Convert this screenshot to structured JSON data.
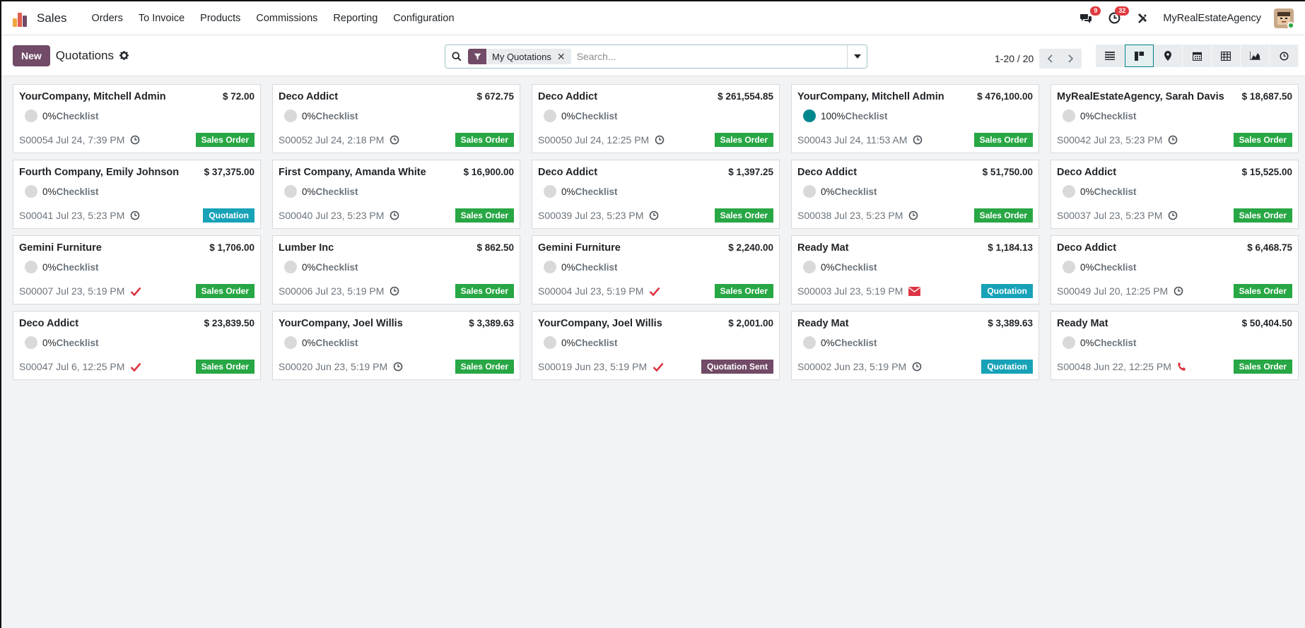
{
  "navbar": {
    "app_name": "Sales",
    "menu": [
      "Orders",
      "To Invoice",
      "Products",
      "Commissions",
      "Reporting",
      "Configuration"
    ],
    "messages_count": "9",
    "activities_count": "32",
    "company": "MyRealEstateAgency"
  },
  "control": {
    "new_label": "New",
    "title": "Quotations",
    "facet_label": "My Quotations",
    "search_placeholder": "Search...",
    "pager": "1-20 / 20"
  },
  "colors": {
    "brand": "#714b67",
    "sales_order": "#28a745",
    "quotation": "#17a2b8",
    "quotation_sent": "#714b67",
    "progress_full": "#00878d"
  },
  "cards": [
    {
      "customer": "YourCompany, Mitchell Admin",
      "amount": "$ 72.00",
      "progress": "0%",
      "checklist": "Checklist",
      "ref": "S00054 Jul 24, 7:39 PM",
      "activity": "clock-icon",
      "status": "Sales Order",
      "status_type": "sales_order"
    },
    {
      "customer": "Deco Addict",
      "amount": "$ 672.75",
      "progress": "0%",
      "checklist": "Checklist",
      "ref": "S00052 Jul 24, 2:18 PM",
      "activity": "clock-icon",
      "status": "Sales Order",
      "status_type": "sales_order"
    },
    {
      "customer": "Deco Addict",
      "amount": "$ 261,554.85",
      "progress": "0%",
      "checklist": "Checklist",
      "ref": "S00050 Jul 24, 12:25 PM",
      "activity": "clock-icon",
      "status": "Sales Order",
      "status_type": "sales_order"
    },
    {
      "customer": "YourCompany, Mitchell Admin",
      "amount": "$ 476,100.00",
      "progress": "100%",
      "checklist": "Checklist",
      "ref": "S00043 Jul 24, 11:53 AM",
      "activity": "clock-icon",
      "status": "Sales Order",
      "status_type": "sales_order"
    },
    {
      "customer": "MyRealEstateAgency, Sarah Davis",
      "amount": "$ 18,687.50",
      "progress": "0%",
      "checklist": "Checklist",
      "ref": "S00042 Jul 23, 5:23 PM",
      "activity": "clock-icon",
      "status": "Sales Order",
      "status_type": "sales_order"
    },
    {
      "customer": "Fourth Company, Emily Johnson",
      "amount": "$ 37,375.00",
      "progress": "0%",
      "checklist": "Checklist",
      "ref": "S00041 Jul 23, 5:23 PM",
      "activity": "clock-icon",
      "status": "Quotation",
      "status_type": "quotation"
    },
    {
      "customer": "First Company, Amanda White",
      "amount": "$ 16,900.00",
      "progress": "0%",
      "checklist": "Checklist",
      "ref": "S00040 Jul 23, 5:23 PM",
      "activity": "clock-icon",
      "status": "Sales Order",
      "status_type": "sales_order"
    },
    {
      "customer": "Deco Addict",
      "amount": "$ 1,397.25",
      "progress": "0%",
      "checklist": "Checklist",
      "ref": "S00039 Jul 23, 5:23 PM",
      "activity": "clock-icon",
      "status": "Sales Order",
      "status_type": "sales_order"
    },
    {
      "customer": "Deco Addict",
      "amount": "$ 51,750.00",
      "progress": "0%",
      "checklist": "Checklist",
      "ref": "S00038 Jul 23, 5:23 PM",
      "activity": "clock-icon",
      "status": "Sales Order",
      "status_type": "sales_order"
    },
    {
      "customer": "Deco Addict",
      "amount": "$ 15,525.00",
      "progress": "0%",
      "checklist": "Checklist",
      "ref": "S00037 Jul 23, 5:23 PM",
      "activity": "clock-icon",
      "status": "Sales Order",
      "status_type": "sales_order"
    },
    {
      "customer": "Gemini Furniture",
      "amount": "$ 1,706.00",
      "progress": "0%",
      "checklist": "Checklist",
      "ref": "S00007 Jul 23, 5:19 PM",
      "activity": "check-icon",
      "status": "Sales Order",
      "status_type": "sales_order"
    },
    {
      "customer": "Lumber Inc",
      "amount": "$ 862.50",
      "progress": "0%",
      "checklist": "Checklist",
      "ref": "S00006 Jul 23, 5:19 PM",
      "activity": "clock-icon",
      "status": "Sales Order",
      "status_type": "sales_order"
    },
    {
      "customer": "Gemini Furniture",
      "amount": "$ 2,240.00",
      "progress": "0%",
      "checklist": "Checklist",
      "ref": "S00004 Jul 23, 5:19 PM",
      "activity": "check-icon",
      "status": "Sales Order",
      "status_type": "sales_order"
    },
    {
      "customer": "Ready Mat",
      "amount": "$ 1,184.13",
      "progress": "0%",
      "checklist": "Checklist",
      "ref": "S00003 Jul 23, 5:19 PM",
      "activity": "envelope-icon",
      "status": "Quotation",
      "status_type": "quotation"
    },
    {
      "customer": "Deco Addict",
      "amount": "$ 6,468.75",
      "progress": "0%",
      "checklist": "Checklist",
      "ref": "S00049 Jul 20, 12:25 PM",
      "activity": "clock-icon",
      "status": "Sales Order",
      "status_type": "sales_order"
    },
    {
      "customer": "Deco Addict",
      "amount": "$ 23,839.50",
      "progress": "0%",
      "checklist": "Checklist",
      "ref": "S00047 Jul 6, 12:25 PM",
      "activity": "check-icon",
      "status": "Sales Order",
      "status_type": "sales_order"
    },
    {
      "customer": "YourCompany, Joel Willis",
      "amount": "$ 3,389.63",
      "progress": "0%",
      "checklist": "Checklist",
      "ref": "S00020 Jun 23, 5:19 PM",
      "activity": "clock-icon",
      "status": "Sales Order",
      "status_type": "sales_order"
    },
    {
      "customer": "YourCompany, Joel Willis",
      "amount": "$ 2,001.00",
      "progress": "0%",
      "checklist": "Checklist",
      "ref": "S00019 Jun 23, 5:19 PM",
      "activity": "check-icon",
      "status": "Quotation Sent",
      "status_type": "quotation_sent"
    },
    {
      "customer": "Ready Mat",
      "amount": "$ 3,389.63",
      "progress": "0%",
      "checklist": "Checklist",
      "ref": "S00002 Jun 23, 5:19 PM",
      "activity": "clock-icon",
      "status": "Quotation",
      "status_type": "quotation"
    },
    {
      "customer": "Ready Mat",
      "amount": "$ 50,404.50",
      "progress": "0%",
      "checklist": "Checklist",
      "ref": "S00048 Jun 22, 12:25 PM",
      "activity": "phone-icon",
      "status": "Sales Order",
      "status_type": "sales_order"
    }
  ]
}
